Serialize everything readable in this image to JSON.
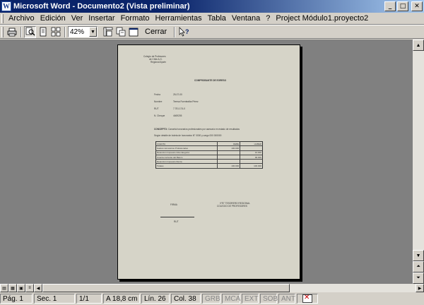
{
  "window": {
    "title": "Microsoft Word - Documento2 (Vista preliminar)",
    "app_icon": "W",
    "controls": [
      "_",
      "□",
      "✕"
    ]
  },
  "menu": [
    "Archivo",
    "Edición",
    "Ver",
    "Insertar",
    "Formato",
    "Herramientas",
    "Tabla",
    "Ventana",
    "?",
    "Project Módulo1.proyecto2"
  ],
  "toolbar": {
    "zoom": "42%",
    "close_label": "Cerrar"
  },
  "document": {
    "header_lines": [
      "Colegio de Profesores",
      "de Chile A.G.",
      "Regional Aysén"
    ],
    "title": "COMPROBANTE DE EGRESO",
    "fields": [
      {
        "label": "Fecha",
        "value": "25-07-00"
      },
      {
        "label": "Nombre",
        "value": "Teresa Fuentealba Pérez"
      },
      {
        "label": "RUT",
        "value": "7.751.174-0"
      },
      {
        "label": "N. Cheque",
        "value": "4469205"
      }
    ],
    "concept_label": "CONCEPTO:",
    "concept_text": "Cancela honorarios profesionales por asesoría en estado de resultados",
    "concept_text2": "Según detalle de boleta de honorarios N° 0000 y cargo 000 000000",
    "table": [
      [
        "CUENTA",
        "DEBE",
        "HABER"
      ],
      [
        "Gastos Honorarios Profesionales",
        "100.000",
        ""
      ],
      [
        "Retención Impuesto 2da categoría",
        "",
        "10.000"
      ],
      [
        "Cuenta corriente del Banco",
        "",
        "90.000"
      ],
      [
        "Retención Impuesto Renta",
        "",
        ""
      ],
      [
        "Totales",
        "100.000",
        "100.000"
      ]
    ],
    "sig_left": "FIRMA",
    "sig_right_lines": [
      "V°B° TESORERO REGIONAL",
      "COLEGIO DE PROFESORES"
    ],
    "sig_bottom": "RUT"
  },
  "status": {
    "page": "Pág. 1",
    "section": "Sec. 1",
    "of": "1/1",
    "position": "A 18,8 cm",
    "line": "Lín. 26",
    "column": "Col. 38",
    "mode1": "GRB",
    "mode2": "MCA",
    "mode3": "EXT",
    "mode4": "SOB",
    "mode5": "ANT"
  }
}
